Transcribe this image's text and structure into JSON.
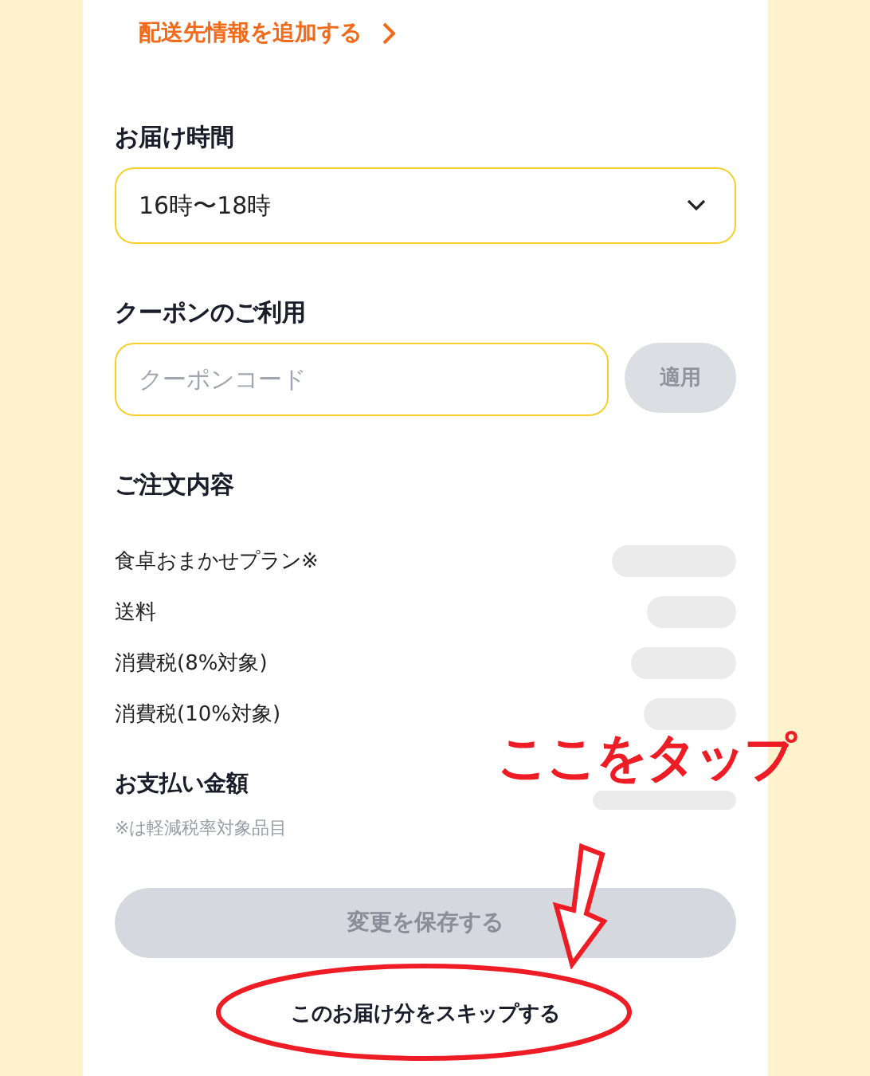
{
  "address_link": {
    "label": "配送先情報を追加する"
  },
  "delivery_time": {
    "heading": "お届け時間",
    "value": "16時〜18時"
  },
  "coupon": {
    "heading": "クーポンのご利用",
    "placeholder": "クーポンコード",
    "apply_button": {
      "label": "適用",
      "disabled": true
    }
  },
  "order": {
    "heading": "ご注文内容",
    "rows": [
      {
        "label": "食卓おまかせプラン※"
      },
      {
        "label": "送料"
      },
      {
        "label": "消費税(8%対象)"
      },
      {
        "label": "消費税(10%対象)"
      }
    ],
    "total_label": "お支払い金額",
    "note": "※は軽減税率対象品目"
  },
  "save_button": {
    "label": "変更を保存する",
    "disabled": true
  },
  "skip_link": {
    "label": "このお届け分をスキップする"
  },
  "annotation": {
    "text": "ここをタップ"
  }
}
